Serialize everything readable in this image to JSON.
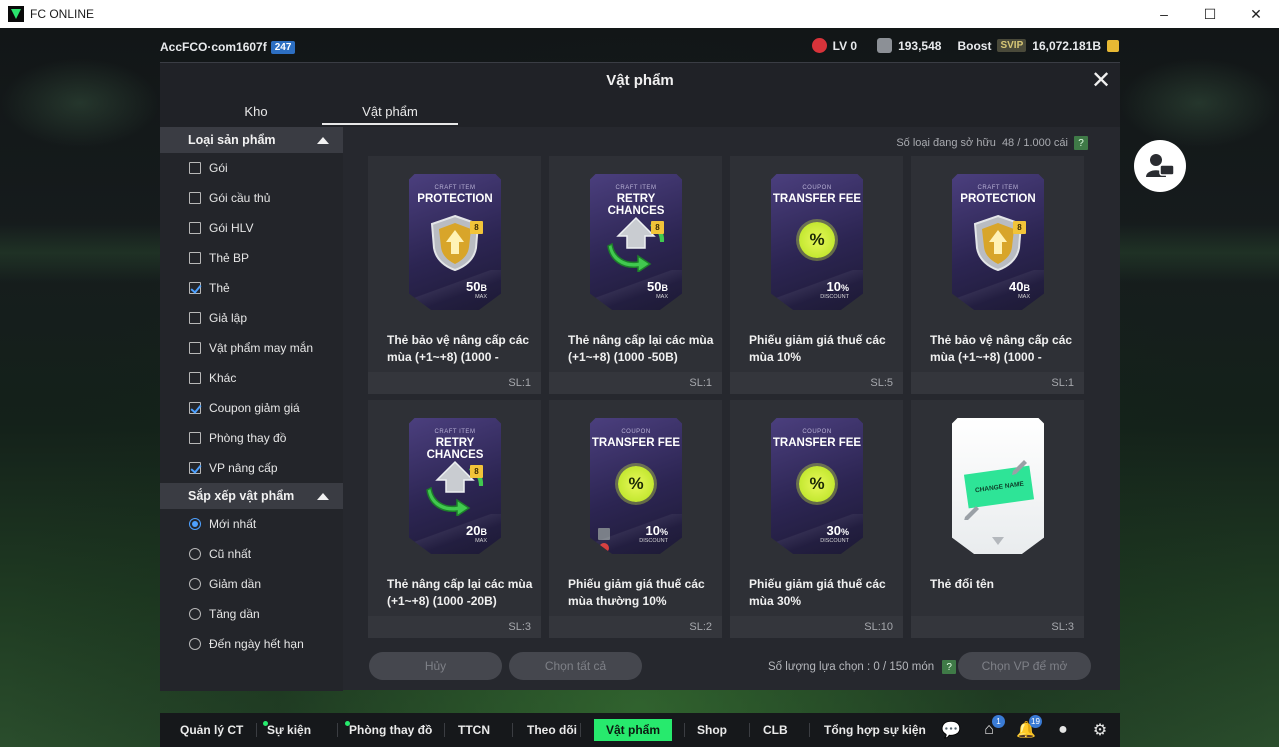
{
  "window": {
    "title": "FC ONLINE",
    "controls": [
      "–",
      "☐",
      "✕"
    ]
  },
  "hud": {
    "account_name": "AccFCO·com1607f",
    "account_badge": "247",
    "level": "LV 0",
    "currency1": "193,548",
    "boost_label": "Boost",
    "svip": "SVIP",
    "currency2": "16,072.181B"
  },
  "modal": {
    "title": "Vật phẩm",
    "tabs": [
      {
        "label": "Kho",
        "active": false
      },
      {
        "label": "Vật phẩm",
        "active": true
      }
    ],
    "owned_label": "Số loại đang sở hữu",
    "owned_value": "48 / 1.000 cái",
    "help": "?",
    "filters": {
      "type_header": "Loại sản phẩm",
      "types": [
        {
          "label": "Gói",
          "checked": false
        },
        {
          "label": "Gói cầu thủ",
          "checked": false
        },
        {
          "label": "Gói HLV",
          "checked": false
        },
        {
          "label": "Thẻ BP",
          "checked": false
        },
        {
          "label": "Thẻ",
          "checked": true
        },
        {
          "label": "Giả lập",
          "checked": false
        },
        {
          "label": "Vật phẩm may mắn",
          "checked": false
        },
        {
          "label": "Khác",
          "checked": false
        },
        {
          "label": "Coupon giảm giá",
          "checked": true
        },
        {
          "label": "Phòng thay đồ",
          "checked": false
        },
        {
          "label": "VP nâng cấp",
          "checked": true
        }
      ],
      "sort_header": "Sắp xếp vật phẩm",
      "sorts": [
        {
          "label": "Mới nhất",
          "selected": true
        },
        {
          "label": "Cũ nhất",
          "selected": false
        },
        {
          "label": "Giảm dần",
          "selected": false
        },
        {
          "label": "Tăng dần",
          "selected": false
        },
        {
          "label": "Đến ngày hết hạn",
          "selected": false
        }
      ]
    },
    "items": [
      {
        "kind": "craft",
        "category": "CRAFT ITEM",
        "card_title": "PROTECTION",
        "value": "50",
        "unit": "B",
        "sub": "MAX",
        "name": "Thẻ bảo vệ nâng cấp các mùa (+1~+8) (1000 -",
        "qty": "SL:1"
      },
      {
        "kind": "craft",
        "category": "CRAFT ITEM",
        "card_title": "RETRY CHANCES",
        "value": "50",
        "unit": "B",
        "sub": "MAX",
        "name": "Thẻ nâng cấp lại các mùa (+1~+8) (1000 -50B)",
        "qty": "SL:1"
      },
      {
        "kind": "coupon",
        "category": "COUPON",
        "card_title": "TRANSFER FEE",
        "value": "10",
        "unit": "%",
        "sub": "DISCOUNT",
        "name": "Phiếu giảm giá thuế các mùa 10%",
        "qty": "SL:5"
      },
      {
        "kind": "craft",
        "category": "CRAFT ITEM",
        "card_title": "PROTECTION",
        "value": "40",
        "unit": "B",
        "sub": "MAX",
        "name": "Thẻ bảo vệ nâng cấp các mùa (+1~+8) (1000 -",
        "qty": "SL:1"
      },
      {
        "kind": "craft",
        "category": "CRAFT ITEM",
        "card_title": "RETRY CHANCES",
        "value": "20",
        "unit": "B",
        "sub": "MAX",
        "name": "Thẻ nâng cấp lại các mùa (+1~+8) (1000 -20B)",
        "qty": "SL:3"
      },
      {
        "kind": "coupon",
        "category": "COUPON",
        "card_title": "TRANSFER FEE",
        "value": "10",
        "unit": "%",
        "sub": "DISCOUNT",
        "name": "Phiếu giảm giá thuế các mùa thường 10%",
        "qty": "SL:2"
      },
      {
        "kind": "coupon",
        "category": "COUPON",
        "card_title": "TRANSFER FEE",
        "value": "30",
        "unit": "%",
        "sub": "DISCOUNT",
        "name": "Phiếu giảm giá thuế các mùa 30%",
        "qty": "SL:10"
      },
      {
        "kind": "rename",
        "category": "",
        "card_title": "CHANGE NAME",
        "value": "",
        "unit": "",
        "sub": "",
        "name": "Thẻ đổi tên",
        "qty": "SL:3"
      }
    ],
    "cancel_label": "Hủy",
    "select_all_label": "Chọn tất cả",
    "selected_label": "Số lượng lựa chọn : 0 / 150 món",
    "choose_label": "Chọn VP để mở"
  },
  "bottom_nav": {
    "items": [
      {
        "label": "Quản lý CT",
        "dot": false,
        "active": false
      },
      {
        "label": "Sự kiện",
        "dot": true,
        "active": false
      },
      {
        "label": "Phòng thay đồ",
        "dot": true,
        "active": false
      },
      {
        "label": "TTCN",
        "dot": false,
        "active": false
      },
      {
        "label": "Theo dõi",
        "dot": false,
        "active": false
      },
      {
        "label": "Vật phẩm",
        "dot": false,
        "active": true
      },
      {
        "label": "Shop",
        "dot": false,
        "active": false
      },
      {
        "label": "CLB",
        "dot": false,
        "active": false
      },
      {
        "label": "Tổng hợp sự kiện",
        "dot": false,
        "active": false
      }
    ],
    "icons": [
      {
        "name": "chat-icon",
        "badge": ""
      },
      {
        "name": "home-icon",
        "badge": "1"
      },
      {
        "name": "bell-icon",
        "badge": "19"
      },
      {
        "name": "profile-icon",
        "badge": ""
      },
      {
        "name": "settings-icon",
        "badge": ""
      }
    ]
  },
  "colors": {
    "accent": "#27ea6d",
    "check": "#4ea1ff",
    "modal_bg": "#26282e"
  }
}
